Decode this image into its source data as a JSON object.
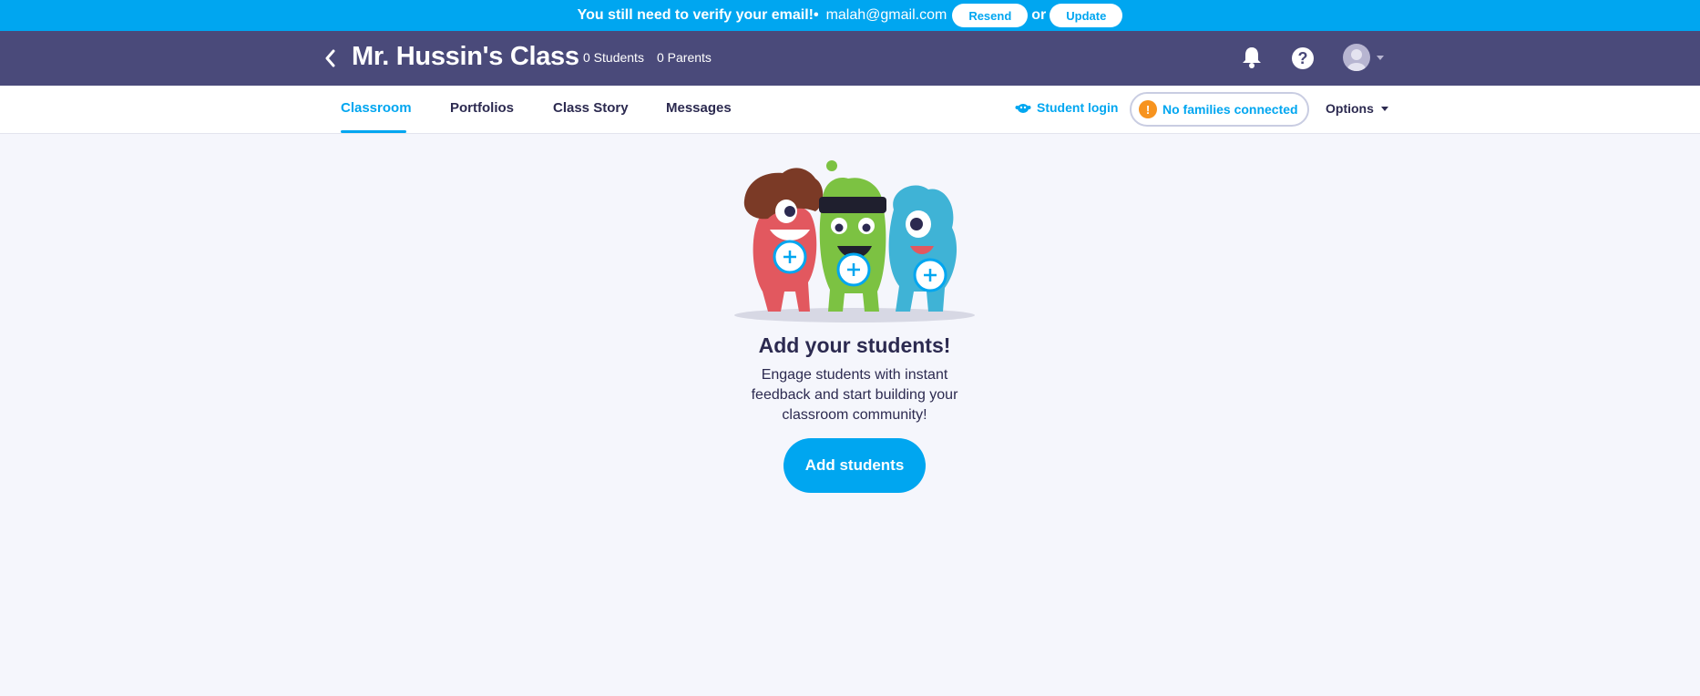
{
  "verify_banner": {
    "message": "You still need to verify your email!•",
    "email": "malah@gmail.com",
    "resend_label": "Resend",
    "or_text": "or",
    "update_label": "Update"
  },
  "class_header": {
    "title": "Mr. Hussin's Class",
    "students_count": "0 Students",
    "parents_count": "0 Parents",
    "icons": [
      "chevron-left-icon",
      "bell-icon",
      "help-icon",
      "avatar-icon"
    ]
  },
  "tabs": [
    {
      "label": "Classroom",
      "active": true
    },
    {
      "label": "Portfolios",
      "active": false
    },
    {
      "label": "Class Story",
      "active": false
    },
    {
      "label": "Messages",
      "active": false
    }
  ],
  "toolbar": {
    "student_login_label": "Student login",
    "families_label": "No families connected",
    "warning_symbol": "!",
    "options_label": "Options"
  },
  "empty_state": {
    "title": "Add your students!",
    "text": "Engage students with instant feedback and start building your classroom community!",
    "button_label": "Add students"
  },
  "colors": {
    "primary_blue": "#00a6f0",
    "header_purple": "#4a4a7a",
    "background": "#f5f6fc",
    "warning_orange": "#f7931e"
  }
}
